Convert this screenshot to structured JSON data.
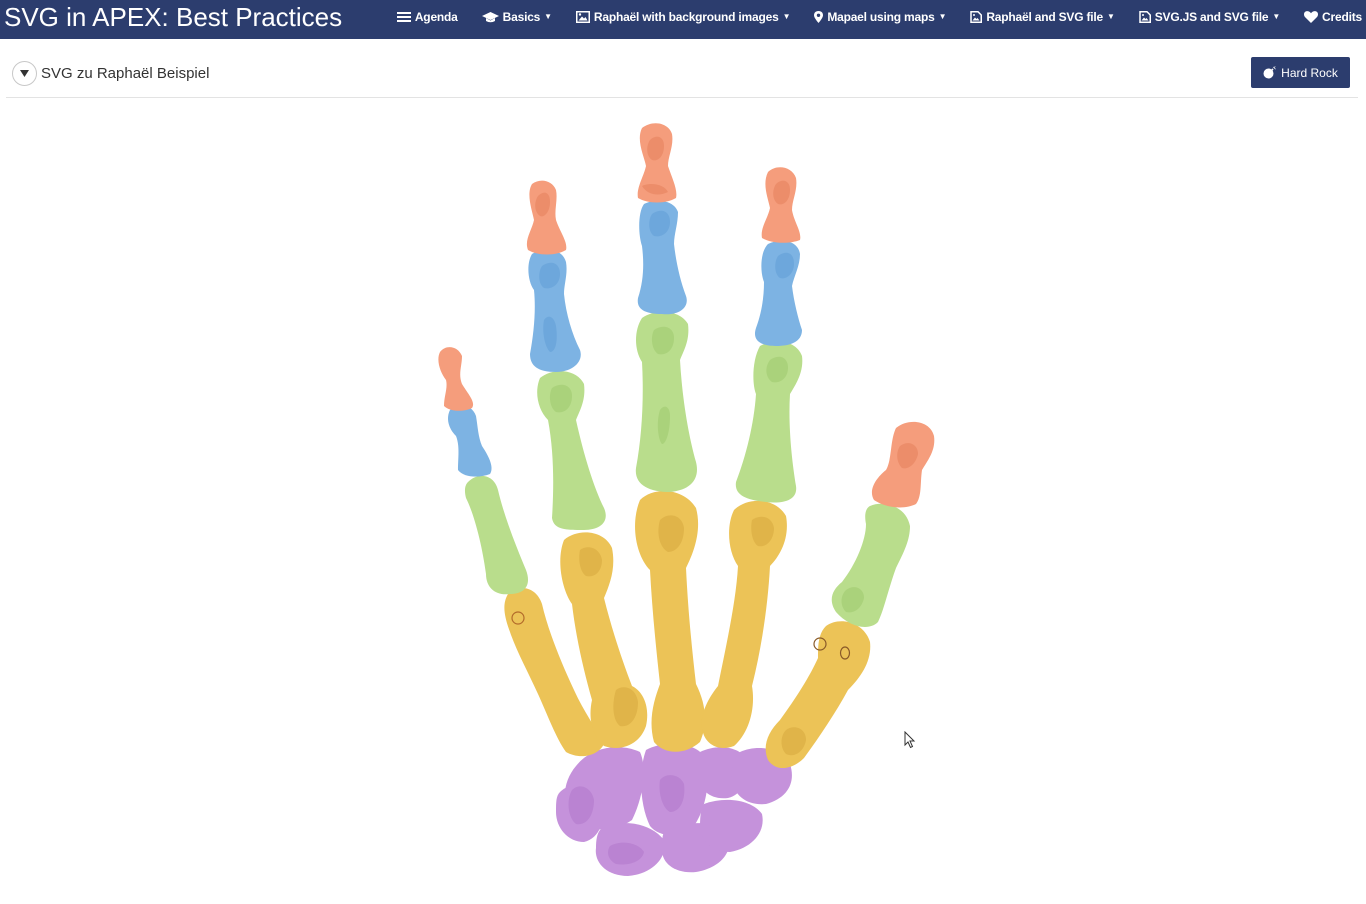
{
  "app": {
    "title": "SVG in APEX: Best Practices"
  },
  "nav": [
    {
      "label": "Agenda",
      "icon": "list-icon",
      "caret": false
    },
    {
      "label": "Basics",
      "icon": "graduation-cap-icon",
      "caret": true
    },
    {
      "label": "Raphaël with background images",
      "icon": "image-icon",
      "caret": true
    },
    {
      "label": "Mapael using maps",
      "icon": "map-marker-icon",
      "caret": true
    },
    {
      "label": "Raphaël and SVG file",
      "icon": "file-image-icon",
      "caret": true
    },
    {
      "label": "SVG.JS and SVG file",
      "icon": "file-image-icon",
      "caret": true
    },
    {
      "label": "Credits",
      "icon": "heart-icon",
      "caret": false
    }
  ],
  "region": {
    "title": "SVG zu Raphaël Beispiel",
    "button_label": "Hard Rock"
  },
  "colors": {
    "navbar": "#2c3d6e",
    "distal_phalanx": "#f59d7c",
    "middle_phalanx": "#7db3e3",
    "proximal_phalanx": "#b9dd8c",
    "metacarpal": "#ecc357",
    "carpal": "#c592db"
  }
}
